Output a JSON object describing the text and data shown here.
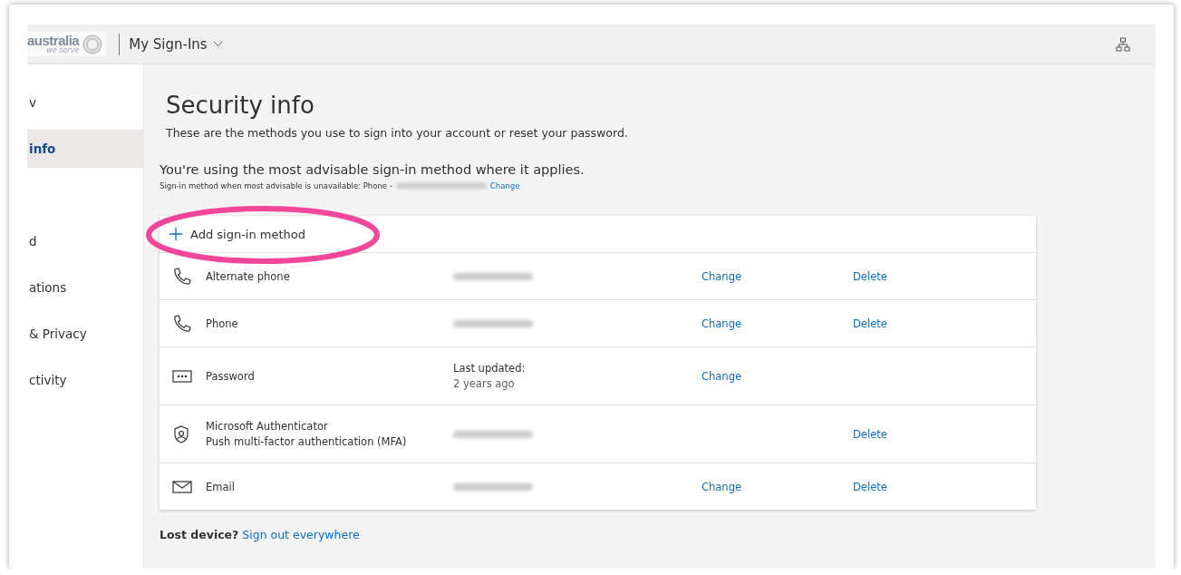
{
  "header": {
    "logo": {
      "wordmark": "australia",
      "tagline": "we serve"
    },
    "app_title": "My Sign-Ins"
  },
  "sidebar": {
    "items": [
      {
        "label": "v",
        "selected": false
      },
      {
        "label": "info",
        "selected": true
      },
      {
        "label": "d",
        "selected": false
      },
      {
        "label": "ations",
        "selected": false
      },
      {
        "label": "& Privacy",
        "selected": false
      },
      {
        "label": "ctivity",
        "selected": false
      }
    ]
  },
  "main": {
    "title": "Security info",
    "subtitle": "These are the methods you use to sign into your account or reset your password.",
    "advisory": "You're using the most advisable sign-in method where it applies.",
    "fallback": {
      "text": "Sign-in method when most advisable is unavailable: Phone -",
      "link": "Change"
    },
    "add_method": "Add sign-in method",
    "methods": [
      {
        "kind": "phone",
        "name": [
          "Alternate phone"
        ],
        "detail_hidden": true,
        "change": "Change",
        "delete": "Delete"
      },
      {
        "kind": "phone",
        "name": [
          "Phone"
        ],
        "detail_hidden": true,
        "change": "Change",
        "delete": "Delete"
      },
      {
        "kind": "password",
        "name": [
          "Password"
        ],
        "detail": [
          "Last updated:",
          "2 years ago"
        ],
        "change": "Change"
      },
      {
        "kind": "authenticator",
        "name": [
          "Microsoft Authenticator",
          "Push multi-factor authentication (MFA)"
        ],
        "detail_hidden": true,
        "delete": "Delete"
      },
      {
        "kind": "email",
        "name": [
          "Email"
        ],
        "detail_hidden": true,
        "change": "Change",
        "delete": "Delete"
      }
    ],
    "lost_device": {
      "text": "**Lost device?**",
      "link": "Sign out everywhere"
    }
  }
}
